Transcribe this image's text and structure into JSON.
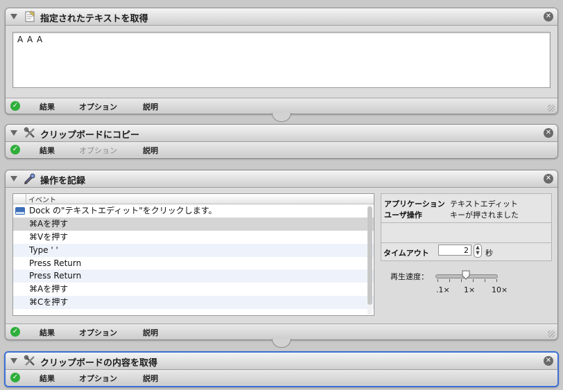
{
  "footer": {
    "results": "結果",
    "options": "オプション",
    "description": "説明"
  },
  "actions": [
    {
      "title": "指定されたテキストを取得",
      "text_value": "A A A"
    },
    {
      "title": "クリップボードにコピー"
    },
    {
      "title": "操作を記録",
      "event_column": "イベント",
      "events": [
        "Dock の\"テキストエディット\"をクリックします。",
        "⌘Aを押す",
        "⌘Vを押す",
        "Type ' '",
        "Press Return",
        "Press Return",
        "⌘Aを押す",
        "⌘Cを押す"
      ],
      "selected_event_index": 1,
      "info": {
        "application_label": "アプリケーション",
        "application_value": "テキストエディット",
        "user_action_label": "ユーザ操作",
        "user_action_value": "キーが押されました",
        "timeout_label": "タイムアウト",
        "timeout_value": "2",
        "timeout_unit": "秒"
      },
      "playback": {
        "label": "再生速度：",
        "min": ".1×",
        "mid": "1×",
        "max": "10×",
        "value": "1×"
      }
    },
    {
      "title": "クリップボードの内容を取得"
    }
  ],
  "colors": {
    "selection_border": "#3a6fd6",
    "ok_green": "#2fae3a"
  }
}
